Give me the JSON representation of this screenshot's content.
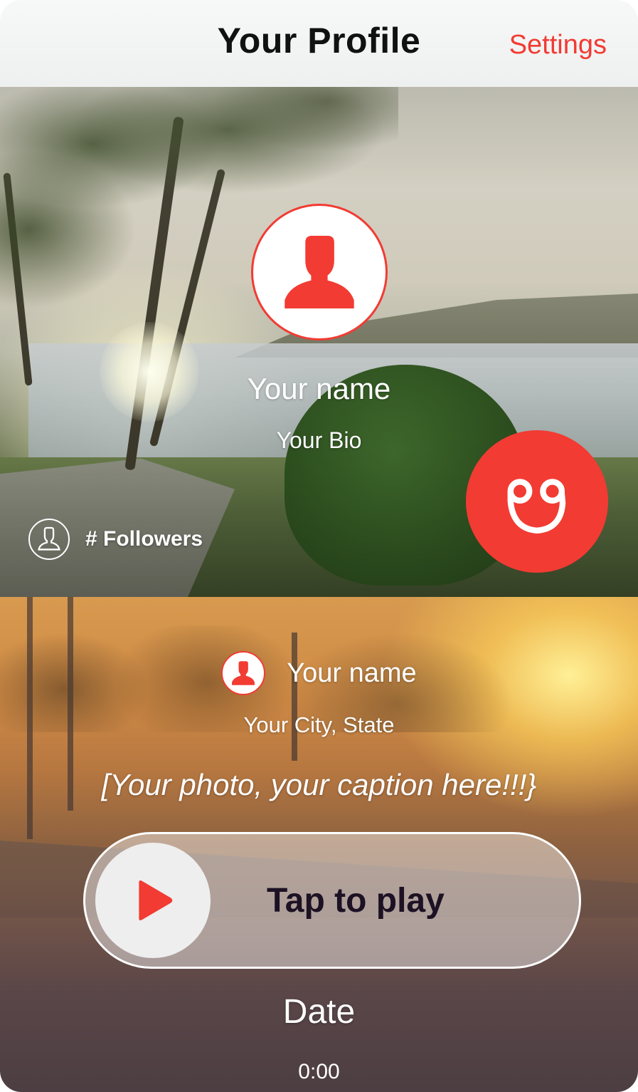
{
  "header": {
    "title": "Your Profile",
    "settings_label": "Settings"
  },
  "profile": {
    "name": "Your name",
    "bio": "Your Bio",
    "followers_label": "# Followers",
    "avatar_icon": "person-icon",
    "fab_icon": "smiley-logo-icon"
  },
  "post": {
    "author_name": "Your name",
    "location": "Your City, State",
    "caption": "[Your photo, your caption here!!!}",
    "play_label": "Tap to play",
    "date": "Date",
    "duration": "0:00",
    "play_icon": "play-icon"
  },
  "colors": {
    "accent": "#f23b33",
    "header_bg": "#f4f5f5",
    "play_label": "#1d1124"
  }
}
